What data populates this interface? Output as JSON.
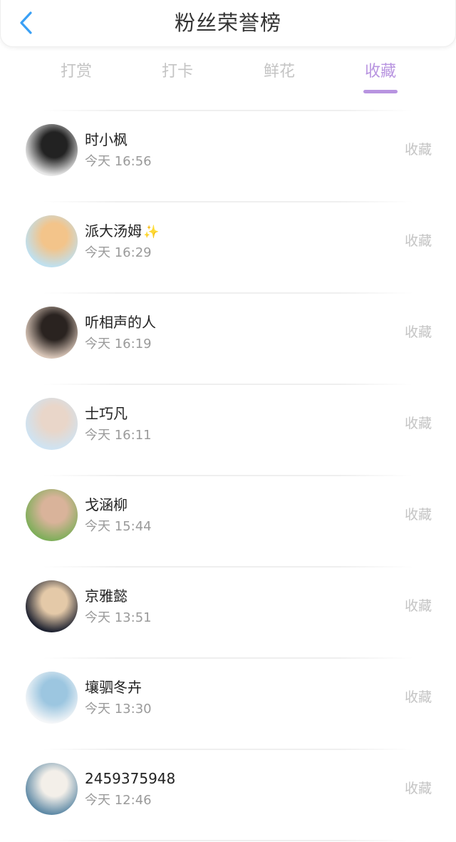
{
  "header": {
    "title": "粉丝荣誉榜",
    "back_icon": "chevron-left-icon",
    "accent": "#3aa0f5"
  },
  "tabs": [
    {
      "label": "打赏",
      "active": false
    },
    {
      "label": "打卡",
      "active": false
    },
    {
      "label": "鲜花",
      "active": false
    },
    {
      "label": "收藏",
      "active": true
    }
  ],
  "colors": {
    "active_tab": "#b894e0",
    "inactive": "#c4c4c4",
    "name": "#222222",
    "time": "#9a9a9a"
  },
  "fans": [
    {
      "name": "时小枫",
      "time": "今天 16:56",
      "action": "收藏",
      "avatar_colors": [
        "#e8e8e8",
        "#222222"
      ]
    },
    {
      "name": "派大汤姆",
      "sparkle": "✨",
      "time": "今天 16:29",
      "action": "收藏",
      "avatar_colors": [
        "#bfe0ef",
        "#f3c48a"
      ]
    },
    {
      "name": "听相声的人",
      "time": "今天 16:19",
      "action": "收藏",
      "avatar_colors": [
        "#d9c6b8",
        "#2a2320"
      ]
    },
    {
      "name": "士巧凡",
      "time": "今天 16:11",
      "action": "收藏",
      "avatar_colors": [
        "#cfe3f2",
        "#e9d6c9"
      ]
    },
    {
      "name": "戈涵柳",
      "time": "今天 15:44",
      "action": "收藏",
      "avatar_colors": [
        "#7fae5a",
        "#d9b39a"
      ]
    },
    {
      "name": "京雅懿",
      "time": "今天 13:51",
      "action": "收藏",
      "avatar_colors": [
        "#1e2230",
        "#e4c9a8"
      ]
    },
    {
      "name": "壤驷冬卉",
      "time": "今天 13:30",
      "action": "收藏",
      "avatar_colors": [
        "#f4f6f8",
        "#9cc6e0"
      ]
    },
    {
      "name": "2459375948",
      "time": "今天 12:46",
      "action": "收藏",
      "avatar_colors": [
        "#5f8aa6",
        "#f3efe9"
      ]
    }
  ]
}
